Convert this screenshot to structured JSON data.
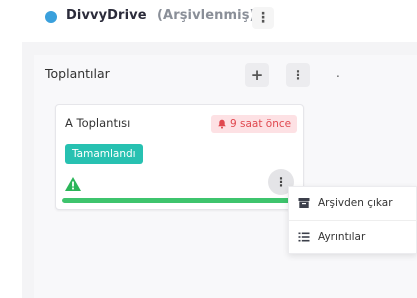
{
  "header": {
    "brand": "DivvyDrive",
    "status": "(Arşivlenmiş)",
    "menu_glyph": "⋮",
    "dot_color": "#3aa0dc"
  },
  "column": {
    "title": "Toplantılar",
    "add_glyph": "+",
    "menu_glyph": "⋮",
    "stray_text": "."
  },
  "card": {
    "title": "A Toplantısı",
    "due_badge": "9 saat önce",
    "status_badge": "Tamamlandı",
    "menu_glyph": "⋮",
    "progress_fraction": 1.0,
    "progress_color": "#3ec46d",
    "warning_color": "#2bb559",
    "due_color": "#e0484f"
  },
  "context_menu": {
    "items": [
      {
        "label": "Arşivden çıkar",
        "icon": "archive-icon"
      },
      {
        "label": "Ayrıntılar",
        "icon": "list-icon"
      }
    ]
  }
}
